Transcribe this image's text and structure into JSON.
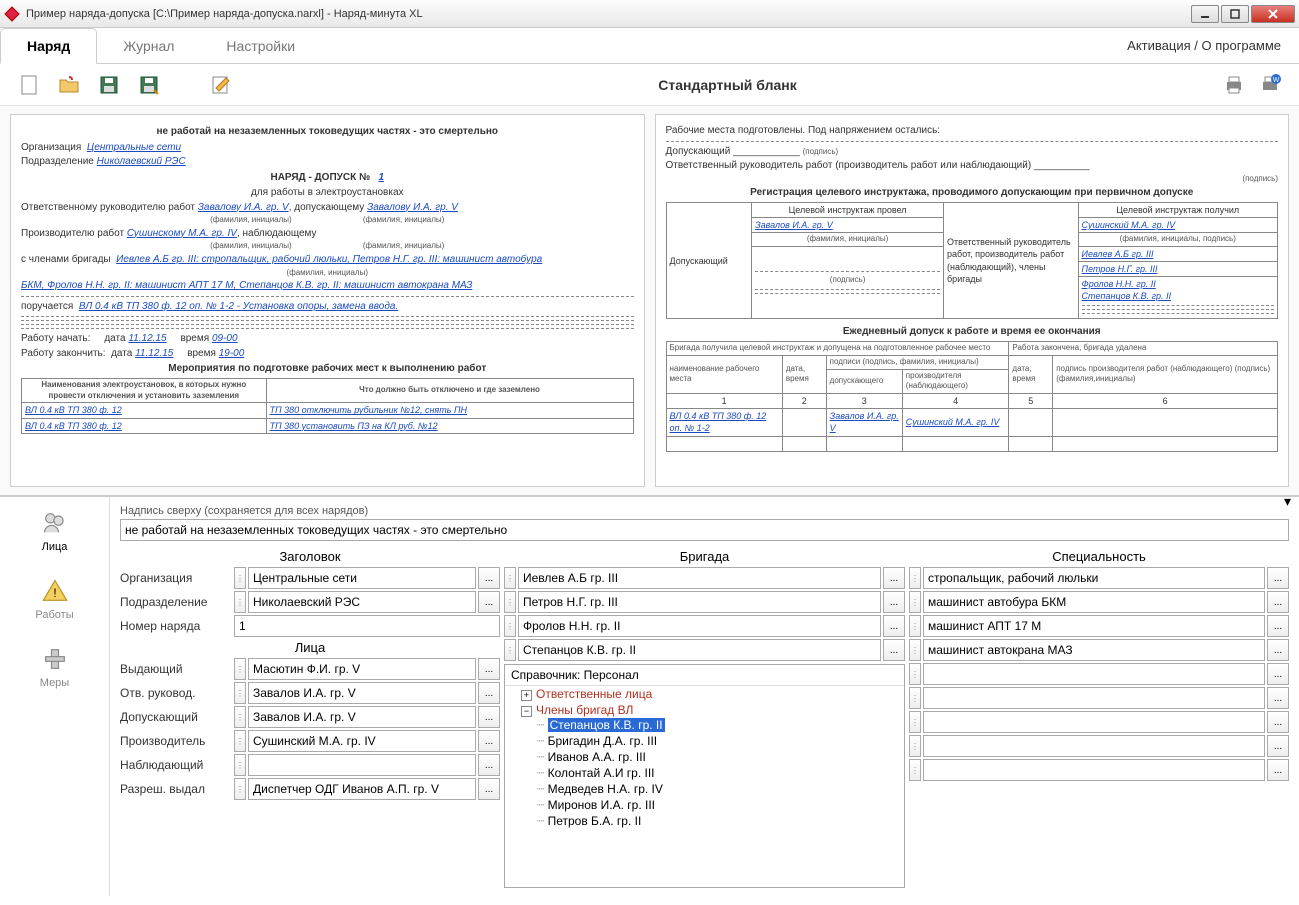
{
  "window": {
    "title": "Пример наряда-допуска  [C:\\Пример наряда-допуска.narxl]  -  Наряд-минута XL"
  },
  "tabs": {
    "t0": "Наряд",
    "t1": "Журнал",
    "t2": "Настройки",
    "activation": "Активация / О программе"
  },
  "toolbar": {
    "center": "Стандартный бланк"
  },
  "doc_left": {
    "warn": "не работай на незаземленных токоведущих частях - это смертельно",
    "org_lbl": "Организация",
    "org_val": "Центральные сети",
    "dept_lbl": "Подразделение",
    "dept_val": "Николаевский РЭС",
    "title": "НАРЯД - ДОПУСК №",
    "num": "1",
    "sub": "для работы в электроустановках",
    "row1a": "Ответственному руководителю работ",
    "row1b": "Завалову И.А. гр. V",
    "row1c": ", допускающему",
    "row1d": "Завалову И.А. гр. V",
    "hint1": "(фамилия, инициалы)",
    "row2a": "Производителю работ",
    "row2b": "Сушинскому М.А. гр. IV",
    "row2c": ", наблюдающему",
    "row3a": "с членами бригады",
    "row3b": "Иевлев А.Б гр. III: стропальщик, рабочий люльки, Петров Н.Г. гр. III: машинист автобура",
    "row3c": "БКМ, Фролов Н.Н. гр. II: машинист АПТ 17 М, Степанцов К.В. гр. II: машинист автокрана МАЗ",
    "row4a": "поручается",
    "row4b": "ВЛ 0.4 кВ ТП 380 ф. 12 оп. № 1-2 - Установка опоры, замена ввода.",
    "start_lbl": "Работу начать:",
    "end_lbl": "Работу закончить:",
    "date_lbl": "дата",
    "time_lbl": "время",
    "start_date": "11.12.15",
    "start_time": "09-00",
    "end_date": "11.12.15",
    "end_time": "19-00",
    "sect2": "Мероприятия по подготовке рабочих мест к выполнению работ",
    "th1": "Наименования электроустановок, в которых нужно провести отключения и установить заземления",
    "th2": "Что должно быть отключено и где заземлено",
    "r1a": "ВЛ 0.4 кВ ТП 380 ф. 12",
    "r1b": "ТП 380 отключить рубильник №12, снять ПН",
    "r2a": "ВЛ 0.4 кВ ТП 380 ф. 12",
    "r2b": "ТП 380 установить ПЗ на КЛ руб. №12"
  },
  "doc_right": {
    "l1": "Рабочие места подготовлены. Под напряжением остались:",
    "l2a": "Допускающий",
    "l2b": "(подпись)",
    "l3": "Ответственный руководитель работ (производитель работ или наблюдающий)",
    "sect1": "Регистрация целевого инструктажа, проводимого допускающим при первичном допуске",
    "th1": "Допускающий",
    "th2": "Целевой инструктаж провел",
    "th3": "Ответственный руководитель работ, производитель работ (наблюдающий), члены бригады",
    "th4": "Целевой инструктаж получил",
    "v1": "Завалов И.А. гр. V",
    "v2": "Сушинский М.А. гр. IV",
    "v3": "Иевлев А.Б гр. III",
    "v4": "Петров Н.Г. гр. III",
    "v5": "Фролов Н.Н. гр. II",
    "v6": "Степанцов К.В. гр. II",
    "hint_fi": "(фамилия, инициалы)",
    "hint_fip": "(фамилия, инициалы, подпись)",
    "hint_sign": "(подпись)",
    "sect2": "Ежедневный допуск к работе и время ее окончания",
    "tab2_h_top_l": "Бригада получила целевой инструктаж и допущена на подготовленное рабочее место",
    "tab2_h_top_r": "Работа закончена, бригада удалена",
    "tab2_h1": "наименование рабочего места",
    "tab2_h2": "дата, время",
    "tab2_h3": "подписи (подпись, фамилия, инициалы)",
    "tab2_h3a": "допускающего",
    "tab2_h3b": "производителя (наблюдающего)",
    "tab2_h4": "дата, время",
    "tab2_h5": "подпись производителя работ (наблюдающего) (подпись)(фамилия,инициалы)",
    "r1a": "ВЛ 0.4 кВ ТП 380 ф. 12 оп. № 1-2",
    "r1c": "Завалов И.А. гр. V",
    "r1d": "Сушинский М.А. гр. IV"
  },
  "editor": {
    "sidebar": {
      "s0": "Лица",
      "s1": "Работы",
      "s2": "Меры"
    },
    "top_label": "Надпись сверху (сохраняется для всех нарядов)",
    "top_input": "не работай на незаземленных токоведущих частях - это смертельно",
    "heads": {
      "c1": "Заголовок",
      "c2": "Бригада",
      "c3": "Специальность",
      "persons": "Лица"
    },
    "left": {
      "org_l": "Организация",
      "org_v": "Центральные сети",
      "dept_l": "Подразделение",
      "dept_v": "Николаевский РЭС",
      "num_l": "Номер наряда",
      "num_v": "1",
      "iss_l": "Выдающий",
      "iss_v": "Масютин Ф.И. гр. V",
      "ruk_l": "Отв. руковод.",
      "ruk_v": "Завалов И.А. гр. V",
      "dop_l": "Допускающий",
      "dop_v": "Завалов И.А. гр. V",
      "prod_l": "Производитель",
      "prod_v": "Сушинский М.А. гр. IV",
      "nab_l": "Наблюдающий",
      "nab_v": "",
      "raz_l": "Разреш. выдал",
      "raz_v": "Диспетчер ОДГ Иванов А.П. гр. V"
    },
    "brigade": {
      "b0": "Иевлев А.Б гр. III",
      "b1": "Петров Н.Г. гр. III",
      "b2": "Фролов Н.Н. гр. II",
      "b3": "Степанцов К.В. гр. II"
    },
    "spec": {
      "s0": "стропальщик, рабочий люльки",
      "s1": "машинист автобура БКМ",
      "s2": "машинист АПТ 17 М",
      "s3": "машинист автокрана МАЗ"
    },
    "tree": {
      "title": "Справочник: Персонал",
      "n0": "Ответственные лица",
      "n1": "Члены бригад ВЛ",
      "leaf_sel": "Степанцов К.В. гр. II",
      "leaf1": "Бригадин Д.А. гр. III",
      "leaf2": "Иванов А.А. гр. III",
      "leaf3": "Колонтай А.И гр. III",
      "leaf4": "Медведев Н.А. гр. IV",
      "leaf5": "Миронов И.А. гр. III",
      "leaf6": "Петров Б.А. гр. II"
    }
  }
}
